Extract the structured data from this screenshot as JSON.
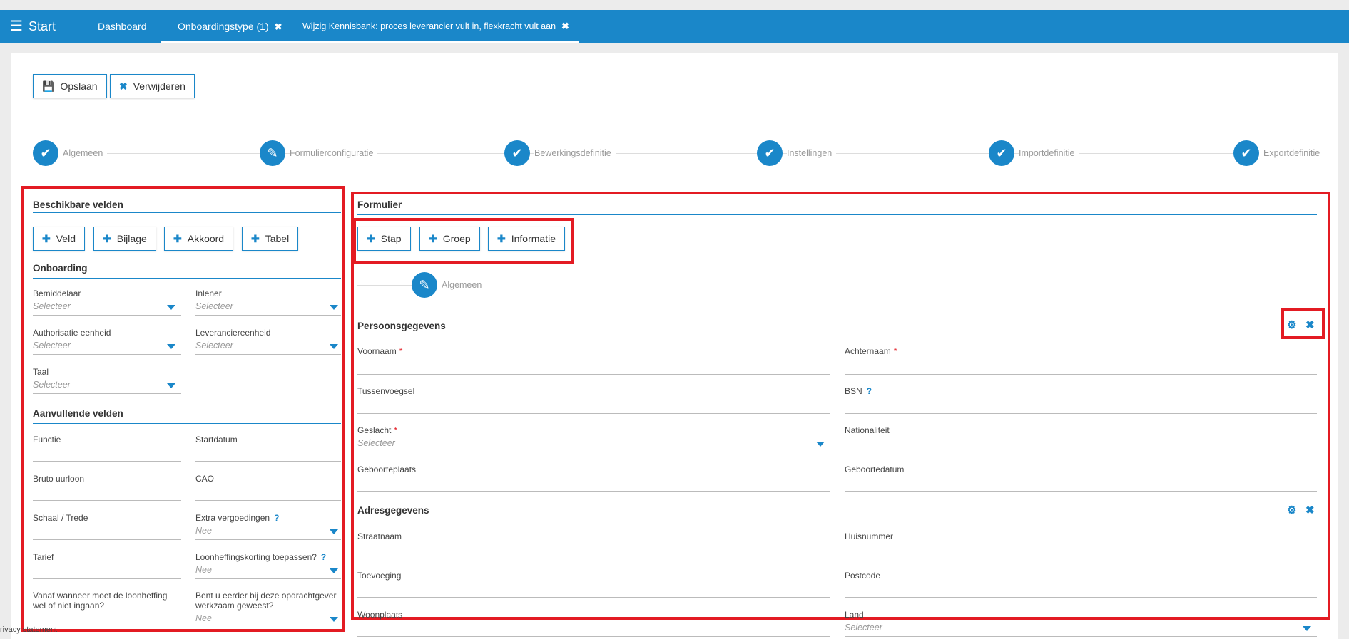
{
  "topbar": {
    "start": "Start",
    "tabs": [
      {
        "label": "Dashboard"
      },
      {
        "label": "Onboardingstype (1)"
      },
      {
        "label": "Wijzig Kennisbank: proces leverancier vult in, flexkracht vult aan"
      }
    ]
  },
  "toolbar": {
    "save": "Opslaan",
    "delete": "Verwijderen"
  },
  "steps": [
    "Algemeen",
    "Formulierconfiguratie",
    "Bewerkingsdefinitie",
    "Instellingen",
    "Importdefinitie",
    "Exportdefinitie"
  ],
  "left": {
    "title": "Beschikbare velden",
    "buttons": [
      "Veld",
      "Bijlage",
      "Akkoord",
      "Tabel"
    ],
    "onboarding_title": "Onboarding",
    "onboarding_fields": [
      {
        "label": "Bemiddelaar",
        "placeholder": "Selecteer"
      },
      {
        "label": "Inlener",
        "placeholder": "Selecteer"
      },
      {
        "label": "Authorisatie eenheid",
        "placeholder": "Selecteer"
      },
      {
        "label": "Leveranciereenheid",
        "placeholder": "Selecteer"
      },
      {
        "label": "Taal",
        "placeholder": "Selecteer"
      }
    ],
    "aanvullende_title": "Aanvullende velden",
    "aanvullende_fields": [
      {
        "label": "Functie"
      },
      {
        "label": "Startdatum"
      },
      {
        "label": "Bruto uurloon"
      },
      {
        "label": "CAO"
      },
      {
        "label": "Schaal / Trede"
      },
      {
        "label": "Extra vergoedingen",
        "help": "?",
        "placeholder": "Nee"
      },
      {
        "label": "Tarief"
      },
      {
        "label": "Loonheffingskorting toepassen?",
        "help": "?",
        "placeholder": "Nee"
      },
      {
        "label": "Vanaf wanneer moet de loonheffing",
        "label2": "wel of niet ingaan?"
      },
      {
        "label": "Bent u eerder bij deze opdrachtgever",
        "label2": "werkzaam geweest?",
        "placeholder": "Nee"
      }
    ]
  },
  "right": {
    "title": "Formulier",
    "buttons": [
      "Stap",
      "Groep",
      "Informatie"
    ],
    "step_label": "Algemeen",
    "persoons_title": "Persoonsgegevens",
    "persoons_fields": [
      {
        "label": "Voornaam",
        "req": "*"
      },
      {
        "label": "Achternaam",
        "req": "*"
      },
      {
        "label": "Tussenvoegsel"
      },
      {
        "label": "BSN",
        "help": "?"
      },
      {
        "label": "Geslacht",
        "req": "*",
        "placeholder": "Selecteer"
      },
      {
        "label": "Nationaliteit"
      },
      {
        "label": "Geboorteplaats"
      },
      {
        "label": "Geboortedatum"
      }
    ],
    "adres_title": "Adresgegevens",
    "adres_fields": [
      {
        "label": "Straatnaam"
      },
      {
        "label": "Huisnummer"
      },
      {
        "label": "Toevoeging"
      },
      {
        "label": "Postcode"
      },
      {
        "label": "Woonplaats"
      },
      {
        "label": "Land",
        "placeholder": "Selecteer"
      }
    ]
  },
  "footer": {
    "privacy": "rivacy statement"
  }
}
